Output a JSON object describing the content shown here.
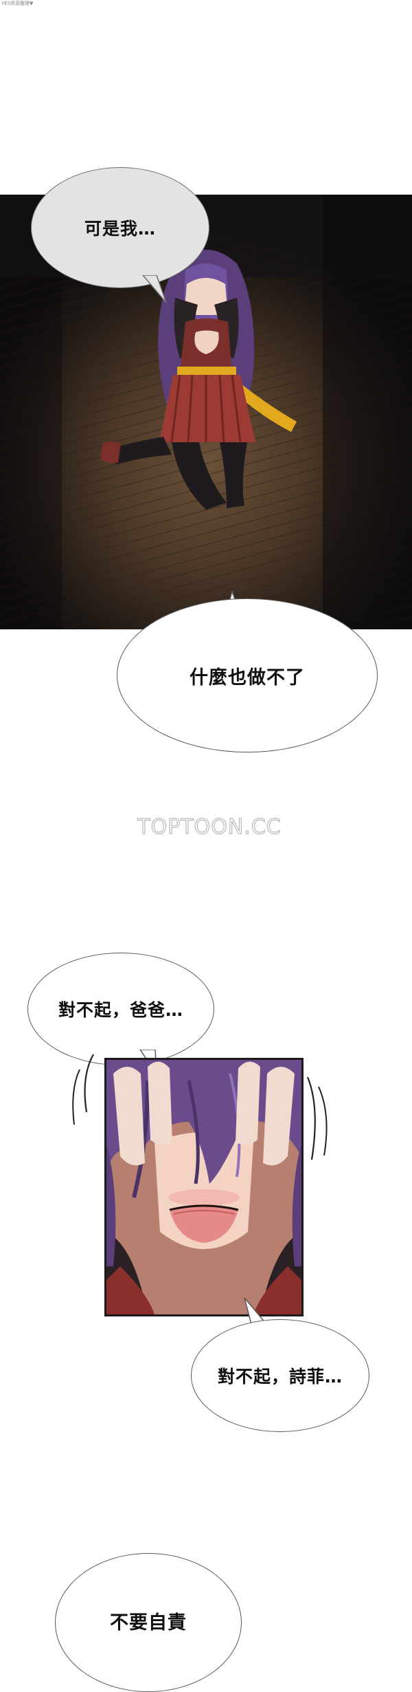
{
  "page": {
    "caption": "YES资源整理▼",
    "watermark": "TOPTOON.CC"
  },
  "panels": [
    {
      "name": "kneeling-girl-panel",
      "description_free": true
    },
    {
      "name": "covering-face-panel",
      "description_free": true
    }
  ],
  "bubbles": {
    "b1": "可是我…",
    "b2": "什麼也做不了",
    "b3": "對不起，爸爸…",
    "b4": "對不起，詩菲…",
    "b5": "不要自責"
  },
  "colors": {
    "bubble_gray": "#e3e3e3",
    "bubble_outline": "#6d6d6d",
    "panel_dark": "#141214",
    "hair_purple": "#6a4c8c",
    "skirt_red": "#9c3a34",
    "ribbon_yellow": "#e2a91e",
    "floor_brown": "#4a3726"
  }
}
